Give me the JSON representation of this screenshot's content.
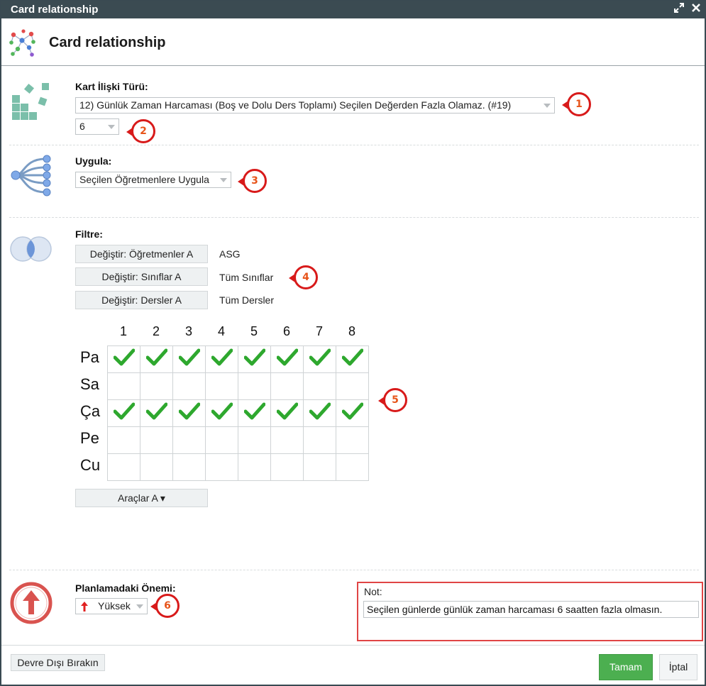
{
  "window": {
    "title": "Card relationship",
    "maximize_icon": "expand-icon",
    "close_icon": "close-icon"
  },
  "header": {
    "title": "Card relationship",
    "icon": "network-nodes-icon"
  },
  "relation": {
    "label": "Kart İlişki Türü:",
    "type_value": "12) Günlük Zaman Harcaması (Boş ve Dolu Ders Toplamı) Seçilen Değerden Fazla Olamaz. (#19)",
    "number_value": "6"
  },
  "apply": {
    "label": "Uygula:",
    "value": "Seçilen Öğretmenlere Uygula"
  },
  "filter": {
    "label": "Filtre:",
    "rows": [
      {
        "button": "Değiştir: Öğretmenler A",
        "value": "ASG"
      },
      {
        "button": "Değiştir: Sınıflar A",
        "value": "Tüm Sınıflar"
      },
      {
        "button": "Değiştir: Dersler A",
        "value": "Tüm Dersler"
      }
    ]
  },
  "grid": {
    "columns": [
      "1",
      "2",
      "3",
      "4",
      "5",
      "6",
      "7",
      "8"
    ],
    "rows": [
      "Pa",
      "Sa",
      "Ça",
      "Pe",
      "Cu"
    ],
    "checked": [
      [
        true,
        true,
        true,
        true,
        true,
        true,
        true,
        true
      ],
      [
        false,
        false,
        false,
        false,
        false,
        false,
        false,
        false
      ],
      [
        true,
        true,
        true,
        true,
        true,
        true,
        true,
        true
      ],
      [
        false,
        false,
        false,
        false,
        false,
        false,
        false,
        false
      ],
      [
        false,
        false,
        false,
        false,
        false,
        false,
        false,
        false
      ]
    ],
    "check_color": "#2ea82e"
  },
  "tools": {
    "label": "Araçlar A ▾"
  },
  "importance": {
    "label": "Planlamadaki Önemi:",
    "value": "Yüksek",
    "arrow_color": "#e02020"
  },
  "note": {
    "label": "Not:",
    "value": "Seçilen günlerde günlük zaman harcaması 6 saatten fazla olmasın."
  },
  "footer": {
    "disable_label": "Devre Dışı Bırakın",
    "ok_label": "Tamam",
    "cancel_label": "İptal",
    "ok_color": "#4caf50"
  },
  "callouts": [
    "1",
    "2",
    "3",
    "4",
    "5",
    "6"
  ],
  "callout_color": "#d81a1a"
}
